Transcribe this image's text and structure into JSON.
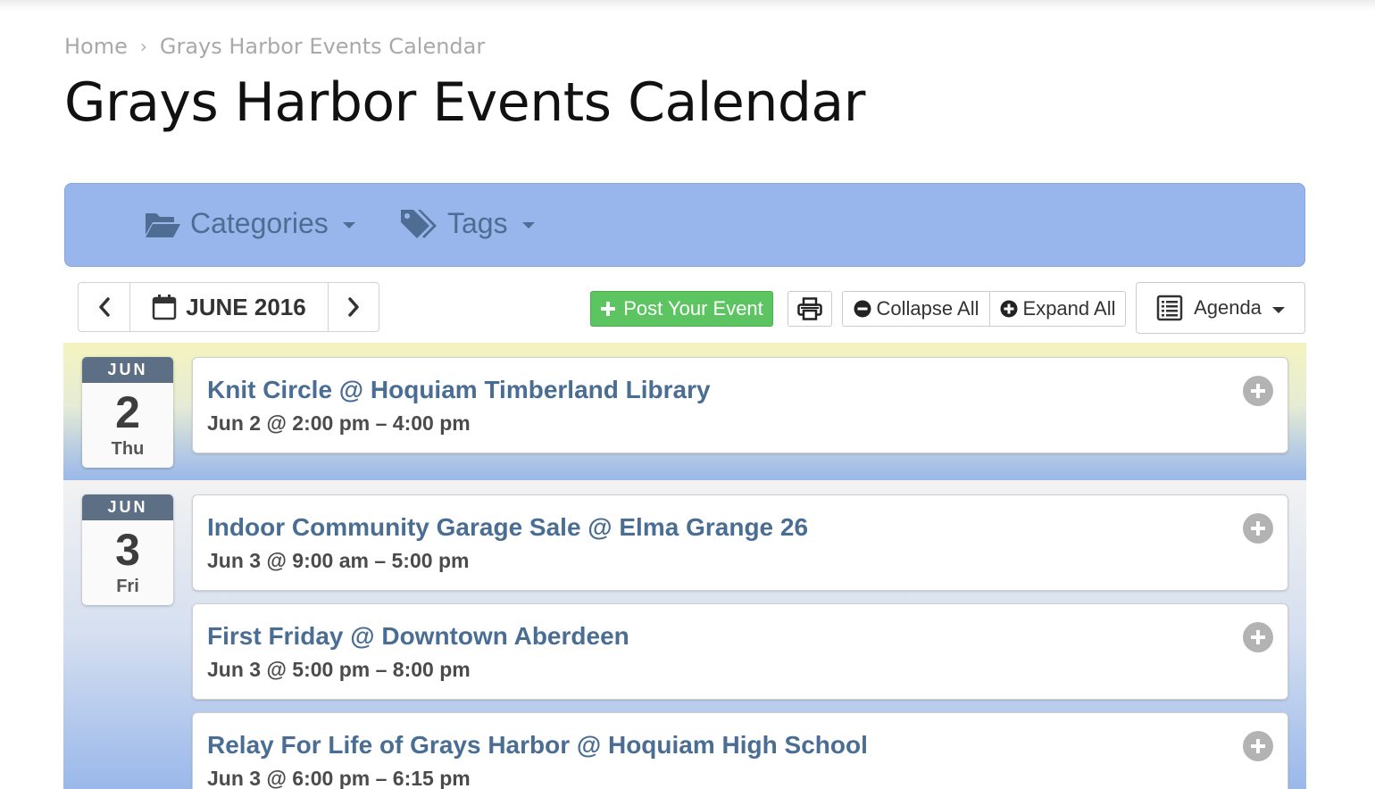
{
  "breadcrumb": {
    "home": "Home",
    "separator": "›",
    "current": "Grays Harbor Events Calendar"
  },
  "page": {
    "title": "Grays Harbor Events Calendar"
  },
  "filters": {
    "categories": "Categories",
    "tags": "Tags"
  },
  "navigation": {
    "month": "JUNE 2016",
    "prev_icon": "chevron-left-icon",
    "next_icon": "chevron-right-icon"
  },
  "toolbar": {
    "post_event": "Post Your Event",
    "print_icon": "print-icon",
    "collapse_all": "Collapse All",
    "expand_all": "Expand All",
    "view": "Agenda"
  },
  "colors": {
    "filter_bar": "#98b6ec",
    "post_button": "#5cc460",
    "event_title": "#4a6d94",
    "badge_header": "#5c6f85"
  },
  "days": [
    {
      "month": "JUN",
      "day": "2",
      "weekday": "Thu",
      "events": [
        {
          "title": "Knit Circle @ Hoquiam Timberland Library",
          "time": "Jun 2 @ 2:00 pm – 4:00 pm"
        }
      ]
    },
    {
      "month": "JUN",
      "day": "3",
      "weekday": "Fri",
      "events": [
        {
          "title": "Indoor Community Garage Sale @ Elma Grange 26",
          "time": "Jun 3 @ 9:00 am – 5:00 pm"
        },
        {
          "title": "First Friday @ Downtown Aberdeen",
          "time": "Jun 3 @ 5:00 pm – 8:00 pm"
        },
        {
          "title": "Relay For Life of Grays Harbor @ Hoquiam High School",
          "time": "Jun 3 @ 6:00 pm – 6:15 pm"
        }
      ]
    }
  ]
}
